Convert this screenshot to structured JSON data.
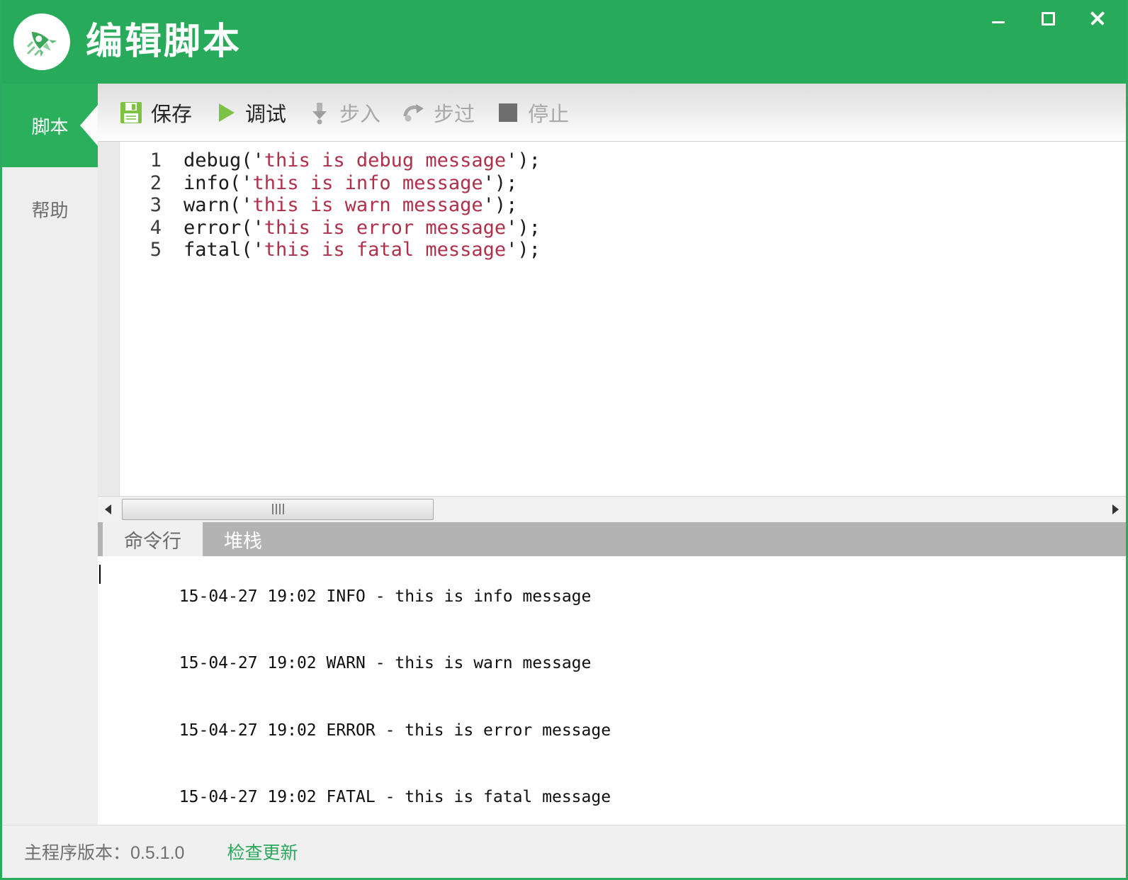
{
  "window": {
    "title": "编辑脚本",
    "logo_icon": "rocket-icon",
    "controls": [
      {
        "name": "minimize",
        "icon": "minimize-icon"
      },
      {
        "name": "maximize",
        "icon": "maximize-icon"
      },
      {
        "name": "close",
        "icon": "close-icon"
      }
    ]
  },
  "sidebar": {
    "items": [
      {
        "label": "脚本",
        "active": true
      },
      {
        "label": "帮助",
        "active": false
      }
    ]
  },
  "toolbar": {
    "buttons": [
      {
        "label": "保存",
        "icon": "save-floppy-icon",
        "enabled": true
      },
      {
        "label": "调试",
        "icon": "play-triangle-icon",
        "enabled": true
      },
      {
        "label": "步入",
        "icon": "step-into-icon",
        "enabled": false
      },
      {
        "label": "步过",
        "icon": "step-over-icon",
        "enabled": false
      },
      {
        "label": "停止",
        "icon": "stop-square-icon",
        "enabled": false
      }
    ]
  },
  "editor": {
    "lines": [
      {
        "number": "1",
        "fn": "debug",
        "open": "('",
        "string": "this is debug message",
        "close": "');"
      },
      {
        "number": "2",
        "fn": "info",
        "open": "('",
        "string": "this is info message",
        "close": "');"
      },
      {
        "number": "3",
        "fn": "warn",
        "open": "('",
        "string": "this is warn message",
        "close": "');"
      },
      {
        "number": "4",
        "fn": "error",
        "open": "('",
        "string": "this is error message",
        "close": "');"
      },
      {
        "number": "5",
        "fn": "fatal",
        "open": "('",
        "string": "this is fatal message",
        "close": "');"
      }
    ]
  },
  "scrollbar": {
    "left_arrow_icon": "triangle-left-icon",
    "right_arrow_icon": "triangle-right-icon",
    "grip_icon": "grip-icon"
  },
  "console": {
    "tabs": [
      {
        "label": "命令行",
        "active": true
      },
      {
        "label": "堆栈",
        "active": false
      }
    ],
    "lines": [
      "15-04-27 19:02 INFO - this is info message",
      "15-04-27 19:02 WARN - this is warn message",
      "15-04-27 19:02 ERROR - this is error message",
      "15-04-27 19:02 FATAL - this is fatal message"
    ]
  },
  "statusbar": {
    "version_text": "主程序版本：0.5.1.0",
    "update_link": "检查更新"
  },
  "colors": {
    "brand_green": "#27ab5b",
    "sidebar_active_green": "#2aaf5d",
    "link_green": "#2aa85a",
    "string_red": "#b0304a",
    "tab_inactive_gray": "#b3b3b3"
  }
}
